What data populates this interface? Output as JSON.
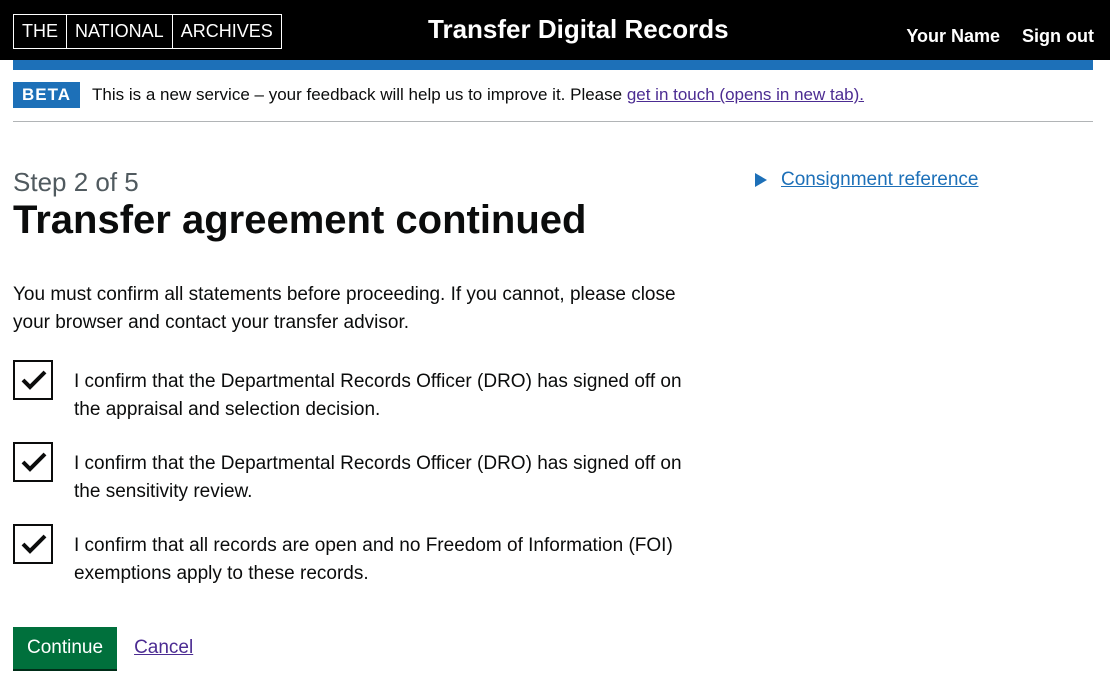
{
  "header": {
    "logo_parts": [
      "THE",
      "NATIONAL",
      "ARCHIVES"
    ],
    "service_name": "Transfer Digital Records",
    "user_name": "Your Name",
    "sign_out": "Sign out"
  },
  "phase_banner": {
    "tag": "BETA",
    "text": "This is a new service – your feedback will help us to improve it. Please ",
    "link": "get in touch (opens in new tab)."
  },
  "main": {
    "caption": "Step 2 of 5",
    "title": "Transfer agreement continued",
    "intro": "You must confirm all statements before proceeding. If you cannot, please close your browser and contact your transfer advisor.",
    "checkboxes": [
      {
        "label": "I confirm that the Departmental Records Officer (DRO) has signed off on the appraisal and selection decision.",
        "checked": true
      },
      {
        "label": "I confirm that the Departmental Records Officer (DRO) has signed off on the sensitivity review.",
        "checked": true
      },
      {
        "label": "I confirm that all records are open and no Freedom of Information (FOI) exemptions apply to these records.",
        "checked": true
      }
    ],
    "continue_label": "Continue",
    "cancel_label": "Cancel"
  },
  "details": {
    "summary": "Consignment reference",
    "icon": "triangle-right-icon"
  },
  "colors": {
    "header_bg": "#000000",
    "accent_blue": "#1d70b8",
    "button_green": "#00703c",
    "visited_link": "#4c2c92"
  }
}
